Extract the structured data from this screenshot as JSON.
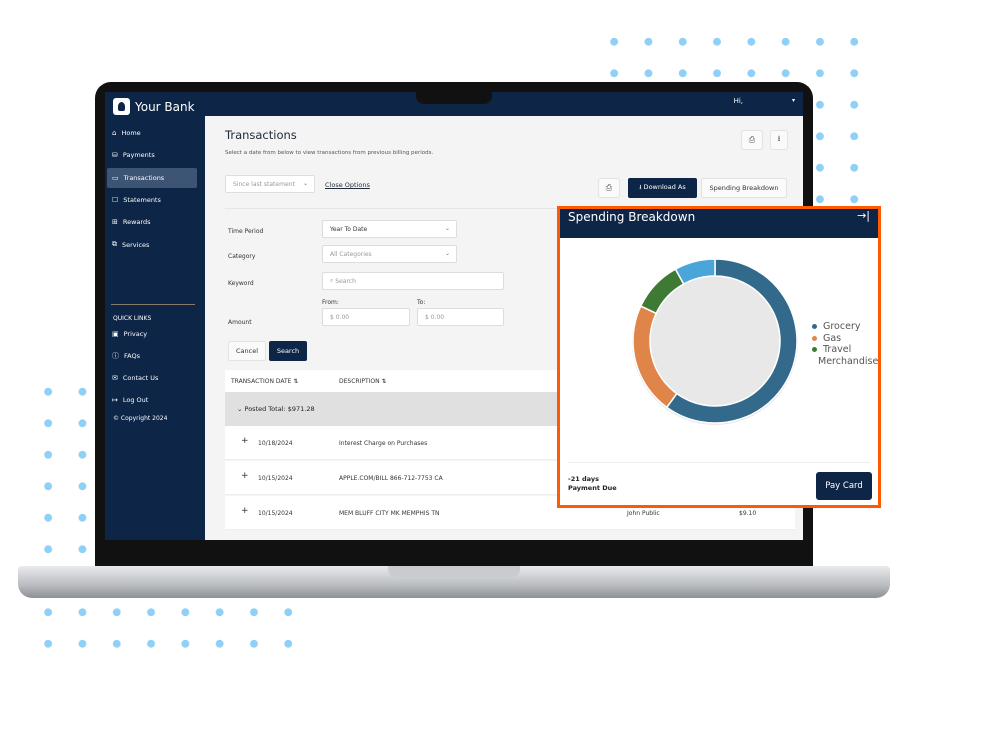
{
  "brand": {
    "name": "Your Bank"
  },
  "topbar": {
    "greeting": "Hi,",
    "menu_icon": "caret-down-icon"
  },
  "sidebar": {
    "items": [
      {
        "label": "Home",
        "icon": "⌂"
      },
      {
        "label": "Payments",
        "icon": "⛁"
      },
      {
        "label": "Transactions",
        "icon": "▭",
        "active": true
      },
      {
        "label": "Statements",
        "icon": "☐"
      },
      {
        "label": "Rewards",
        "icon": "⊞"
      },
      {
        "label": "Services",
        "icon": "⧉"
      }
    ],
    "quick_links_title": "QUICK LINKS",
    "quick_links": [
      {
        "label": "Privacy",
        "icon": "▣"
      },
      {
        "label": "FAQs",
        "icon": "ⓘ"
      },
      {
        "label": "Contact Us",
        "icon": "✉"
      },
      {
        "label": "Log Out",
        "icon": "↦"
      }
    ],
    "copyright": "© Copyright 2024"
  },
  "main": {
    "title": "Transactions",
    "subtitle": "Select a date from below to view transactions from previous billing periods.",
    "period_select": "Since last statement",
    "close_options": "Close Options",
    "download_as": "⭳ Download As",
    "spending_breakdown": "Spending Breakdown",
    "filters": {
      "time_period_label": "Time Period",
      "time_period_value": "Year To Date",
      "category_label": "Category",
      "category_value": "All Categories",
      "keyword_label": "Keyword",
      "keyword_placeholder": "Search",
      "amount_label": "Amount",
      "from_label": "From:",
      "to_label": "To:",
      "from_placeholder": "$ 0.00",
      "to_placeholder": "$ 0.00"
    },
    "cancel": "Cancel",
    "search": "Search",
    "table": {
      "headers": [
        "TRANSACTION DATE ⇅",
        "DESCRIPTION ⇅"
      ],
      "group_label": "⌄  Posted Total: $971.28",
      "rows": [
        {
          "date": "10/18/2024",
          "description": "Interest Charge on Purchases",
          "name": "",
          "amount": ""
        },
        {
          "date": "10/15/2024",
          "description": "APPLE.COM/BILL 866-712-7753 CA",
          "name": "",
          "amount": ""
        },
        {
          "date": "10/15/2024",
          "description": "MEM BLUFF CITY MK MEMPHIS TN",
          "name": "John Public",
          "amount": "$9.10"
        }
      ]
    }
  },
  "panel": {
    "title": "Spending Breakdown",
    "collapse_icon": "→|",
    "due_days": "-21 days",
    "due_label": "Payment Due",
    "pay_button": "Pay Card"
  },
  "chart_data": {
    "type": "pie",
    "donut": true,
    "categories": [
      "Grocery",
      "Gas",
      "Travel",
      "Merchandise"
    ],
    "values": [
      60,
      22,
      10,
      8
    ],
    "colors": [
      "#336a8c",
      "#e0854a",
      "#3f7a34",
      "#4aa6d8"
    ],
    "legend": "right"
  },
  "colors": {
    "navy": "#0d2547",
    "accent_border": "#ff5a00",
    "dots": "#8fd0f7"
  }
}
